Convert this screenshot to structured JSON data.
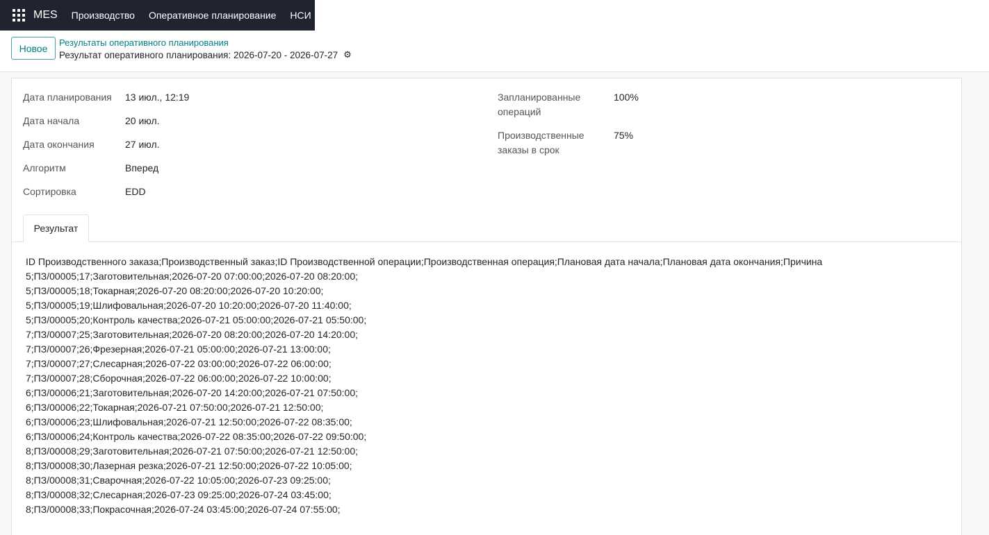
{
  "navbar": {
    "apps_icon": "grid-apps-icon",
    "brand": "MES",
    "menu": [
      "Производство",
      "Оперативное планирование",
      "НСИ"
    ]
  },
  "control_panel": {
    "new_button": "Новое",
    "breadcrumb": "Результаты оперативного планирования",
    "title": "Результат оперативного планирования: 2026-07-20 - 2026-07-27",
    "gear_icon": "gear-icon"
  },
  "form": {
    "left_fields": [
      {
        "label": "Дата планирования",
        "value": "13 июл., 12:19"
      },
      {
        "label": "Дата начала",
        "value": "20 июл."
      },
      {
        "label": "Дата окончания",
        "value": "27 июл."
      },
      {
        "label": "Алгоритм",
        "value": "Вперед"
      },
      {
        "label": "Сортировка",
        "value": "EDD"
      }
    ],
    "right_fields": [
      {
        "label_line1": "Запланированные",
        "label_line2": "операций",
        "value": "100%"
      },
      {
        "label_line1": "Производственные",
        "label_line2": "заказы в срок",
        "value": "75%"
      }
    ]
  },
  "tabs": [
    "Результат"
  ],
  "result_lines": [
    "ID Производственного заказа;Производственный заказ;ID Производственной операции;Производственная операция;Плановая дата начала;Плановая дата окончания;Причина",
    "5;ПЗ/00005;17;Заготовительная;2026-07-20 07:00:00;2026-07-20 08:20:00;",
    "5;ПЗ/00005;18;Токарная;2026-07-20 08:20:00;2026-07-20 10:20:00;",
    "5;ПЗ/00005;19;Шлифовальная;2026-07-20 10:20:00;2026-07-20 11:40:00;",
    "5;ПЗ/00005;20;Контроль качества;2026-07-21 05:00:00;2026-07-21 05:50:00;",
    "7;ПЗ/00007;25;Заготовительная;2026-07-20 08:20:00;2026-07-20 14:20:00;",
    "7;ПЗ/00007;26;Фрезерная;2026-07-21 05:00:00;2026-07-21 13:00:00;",
    "7;ПЗ/00007;27;Слесарная;2026-07-22 03:00:00;2026-07-22 06:00:00;",
    "7;ПЗ/00007;28;Сборочная;2026-07-22 06:00:00;2026-07-22 10:00:00;",
    "6;ПЗ/00006;21;Заготовительная;2026-07-20 14:20:00;2026-07-21 07:50:00;",
    "6;ПЗ/00006;22;Токарная;2026-07-21 07:50:00;2026-07-21 12:50:00;",
    "6;ПЗ/00006;23;Шлифовальная;2026-07-21 12:50:00;2026-07-22 08:35:00;",
    "6;ПЗ/00006;24;Контроль качества;2026-07-22 08:35:00;2026-07-22 09:50:00;",
    "8;ПЗ/00008;29;Заготовительная;2026-07-21 07:50:00;2026-07-21 12:50:00;",
    "8;ПЗ/00008;30;Лазерная резка;2026-07-21 12:50:00;2026-07-22 10:05:00;",
    "8;ПЗ/00008;31;Сварочная;2026-07-22 10:05:00;2026-07-23 09:25:00;",
    "8;ПЗ/00008;32;Слесарная;2026-07-23 09:25:00;2026-07-24 03:45:00;",
    "8;ПЗ/00008;33;Покрасочная;2026-07-24 03:45:00;2026-07-24 07:55:00;"
  ]
}
